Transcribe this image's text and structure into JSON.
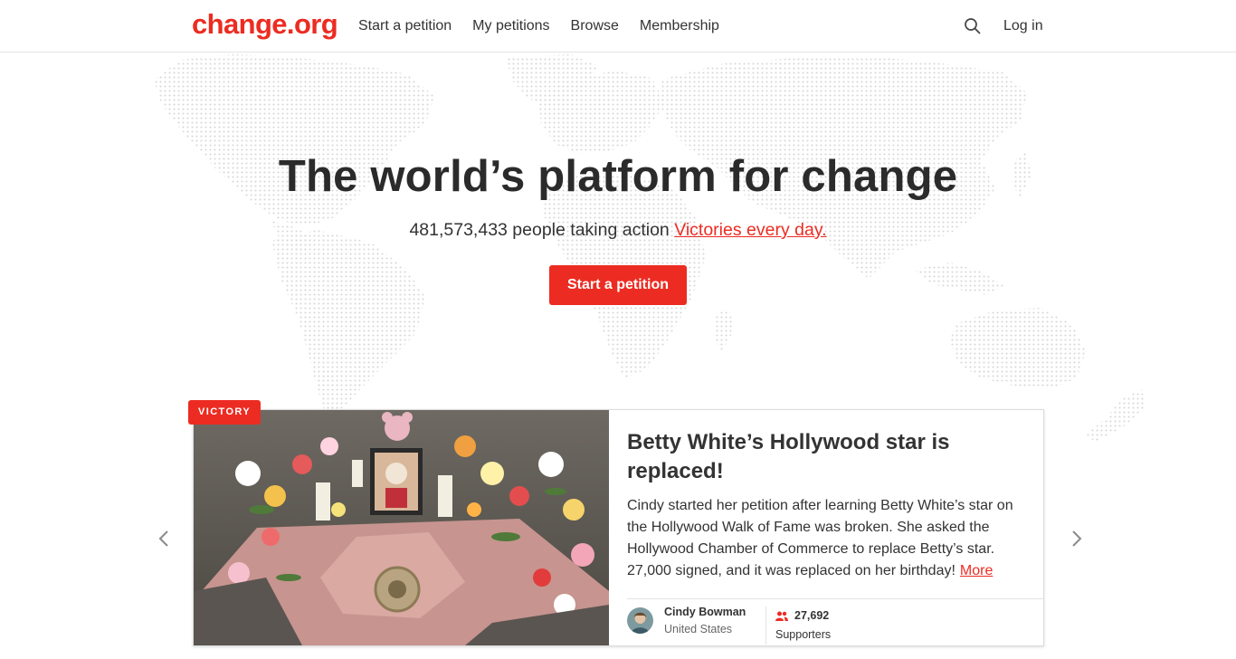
{
  "header": {
    "logo": "change.org",
    "nav": [
      "Start a petition",
      "My petitions",
      "Browse",
      "Membership"
    ],
    "login": "Log in",
    "search_icon": "search-icon"
  },
  "hero": {
    "title": "The world’s platform for change",
    "count_text": "481,573,433 people taking action",
    "victories_link": "Victories every day.",
    "cta": "Start a petition"
  },
  "carousel": {
    "badge": "VICTORY",
    "title": "Betty White’s Hollywood star is replaced!",
    "description": "Cindy started her petition after learning Betty White’s star on the Hollywood Walk of Fame was broken. She asked the Hollywood Chamber of Commerce to replace Betty’s star. 27,000 signed, and it was replaced on her birthday!",
    "more": "More",
    "author": {
      "name": "Cindy Bowman",
      "location": "United States"
    },
    "supporters": {
      "count": "27,692",
      "label": "Supporters"
    },
    "prev_icon": "chevron-left-icon",
    "next_icon": "chevron-right-icon"
  },
  "colors": {
    "brand": "#ec2c22",
    "text": "#333333",
    "border": "#e3e3e3"
  }
}
